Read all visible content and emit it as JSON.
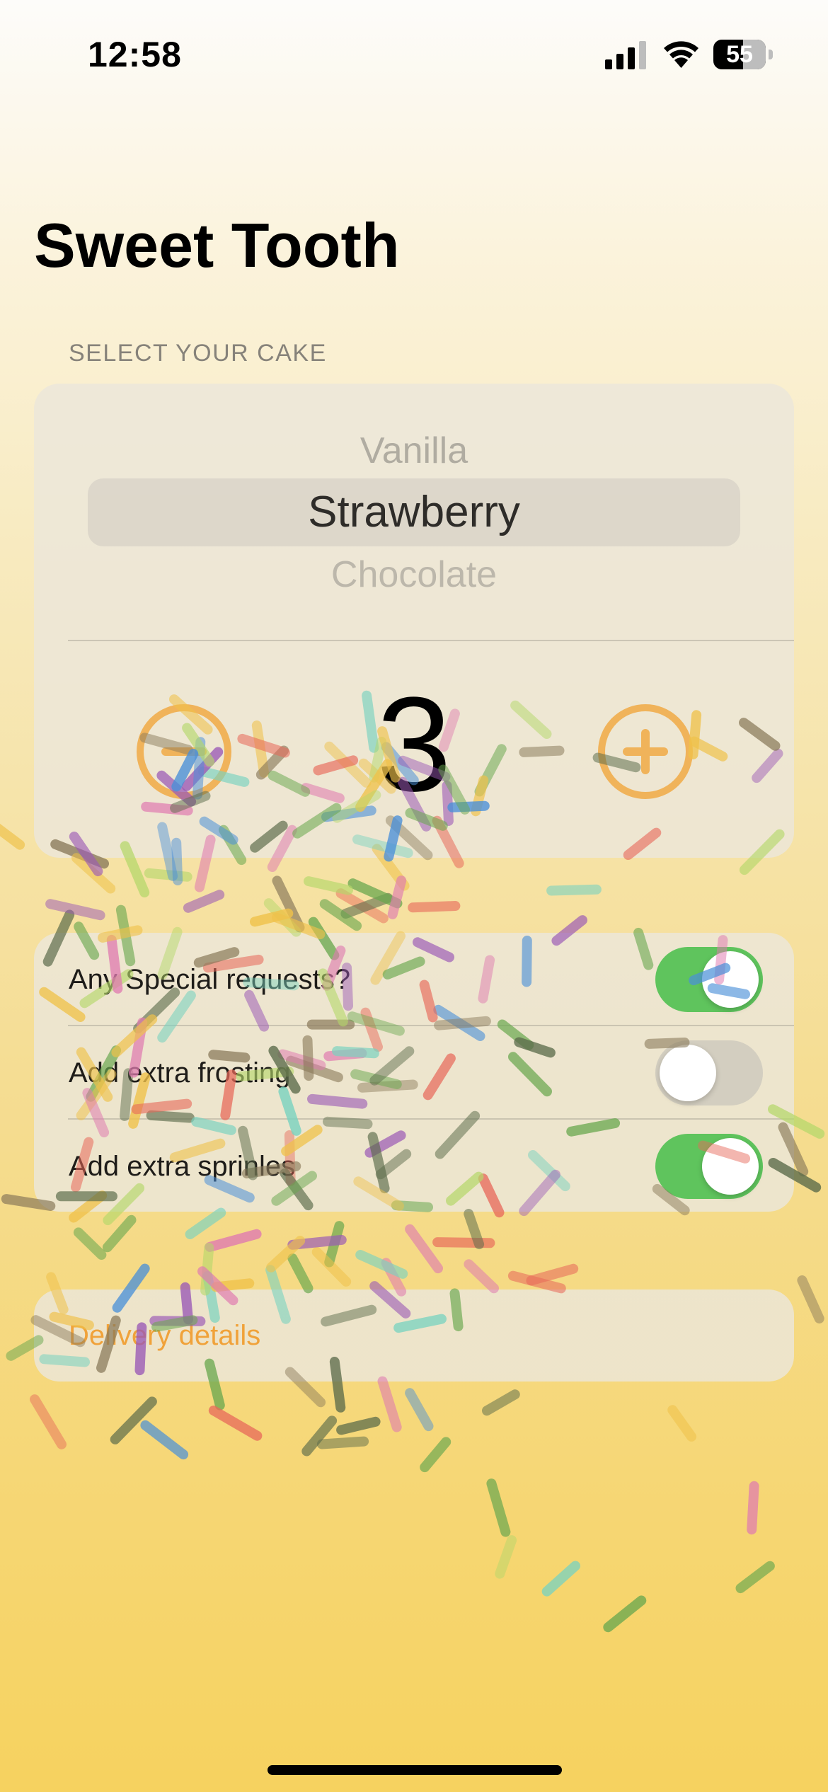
{
  "status_bar": {
    "time": "12:58",
    "battery_percent": "55"
  },
  "app": {
    "title": "Sweet Tooth"
  },
  "cake_section": {
    "header": "SELECT YOUR CAKE",
    "picker": {
      "previous": "Vanilla",
      "selected": "Strawberry",
      "next": "Chocolate"
    },
    "quantity": "3"
  },
  "options": [
    {
      "label": "Any Special requests?",
      "on": true
    },
    {
      "label": "Add extra frosting",
      "on": false
    },
    {
      "label": "Add extra sprinles",
      "on": true
    }
  ],
  "delivery": {
    "label": "Delivery details"
  },
  "colors": {
    "accent": "#f0a23a",
    "toggle_on": "#5fc45d",
    "stepper": "#f0b35a"
  },
  "decoration": {
    "sprinkle_colors": [
      "#e8695a",
      "#6aa84f",
      "#9b59b6",
      "#4a90d9",
      "#8a7a5a",
      "#e07bb0",
      "#b5d86a",
      "#f0c24a",
      "#7ad3c0",
      "#5b6b4a"
    ]
  }
}
